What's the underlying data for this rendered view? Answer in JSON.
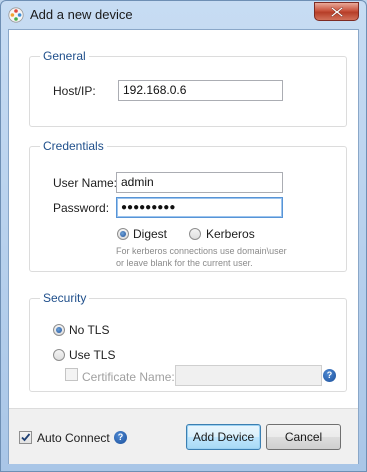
{
  "window": {
    "title": "Add a new device"
  },
  "general": {
    "legend": "General",
    "host_label": "Host/IP:",
    "host_value": "192.168.0.6"
  },
  "credentials": {
    "legend": "Credentials",
    "username_label": "User Name:",
    "username_value": "admin",
    "password_label": "Password:",
    "password_value": "●●●●●●●●●",
    "auth_options": [
      {
        "label": "Digest",
        "selected": true
      },
      {
        "label": "Kerberos",
        "selected": false
      }
    ],
    "hint_line1": "For kerberos connections use domain\\user",
    "hint_line2": "or leave blank for the current user."
  },
  "security": {
    "legend": "Security",
    "no_tls_label": "No TLS",
    "use_tls_label": "Use TLS",
    "selected": "No TLS",
    "cert_label": "Certificate Name:",
    "cert_value": ""
  },
  "footer": {
    "auto_connect_label": "Auto Connect",
    "auto_connect_checked": true,
    "add_button": "Add Device",
    "cancel_button": "Cancel"
  },
  "icons": {
    "app": "device-icon",
    "close": "close-icon",
    "help": "help-icon"
  },
  "colors": {
    "legend_text": "#1f4f8b",
    "close_button": "#c9543e",
    "primary_button": "#bee6fd"
  }
}
